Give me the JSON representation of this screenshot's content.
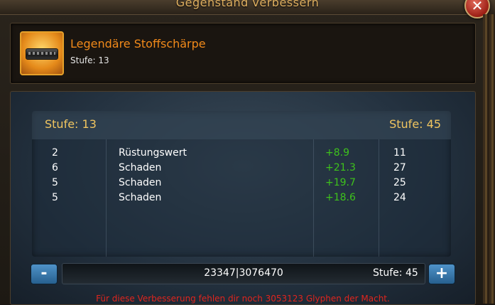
{
  "window": {
    "title": "Gegenstand verbessern"
  },
  "item": {
    "name": "Legendäre Stoffschärpe",
    "level_text": "Stufe: 13",
    "icon": "belt-icon"
  },
  "upgrade": {
    "current_level_text": "Stufe: 13",
    "target_level_header_text": "Stufe: 45",
    "stats": [
      {
        "base": "2",
        "name": "Rüstungswert",
        "bonus": "+8.9",
        "new": "11"
      },
      {
        "base": "6",
        "name": "Schaden",
        "bonus": "+21.3",
        "new": "27"
      },
      {
        "base": "5",
        "name": "Schaden",
        "bonus": "+19.7",
        "new": "25"
      },
      {
        "base": "5",
        "name": "Schaden",
        "bonus": "+18.6",
        "new": "24"
      }
    ],
    "controls": {
      "minus_label": "-",
      "plus_label": "+",
      "glyphs_value": "23347|3076470",
      "target_level_text": "Stufe: 45"
    },
    "warning": "Für diese Verbesserung fehlen dir noch 3053123 Glyphen der Macht."
  },
  "colors": {
    "item_name": "#f28a1a",
    "level_gold": "#f0c560",
    "bonus_green": "#3ec21c",
    "warning_red": "#e0251e",
    "button_blue": "#3d7fb5"
  }
}
